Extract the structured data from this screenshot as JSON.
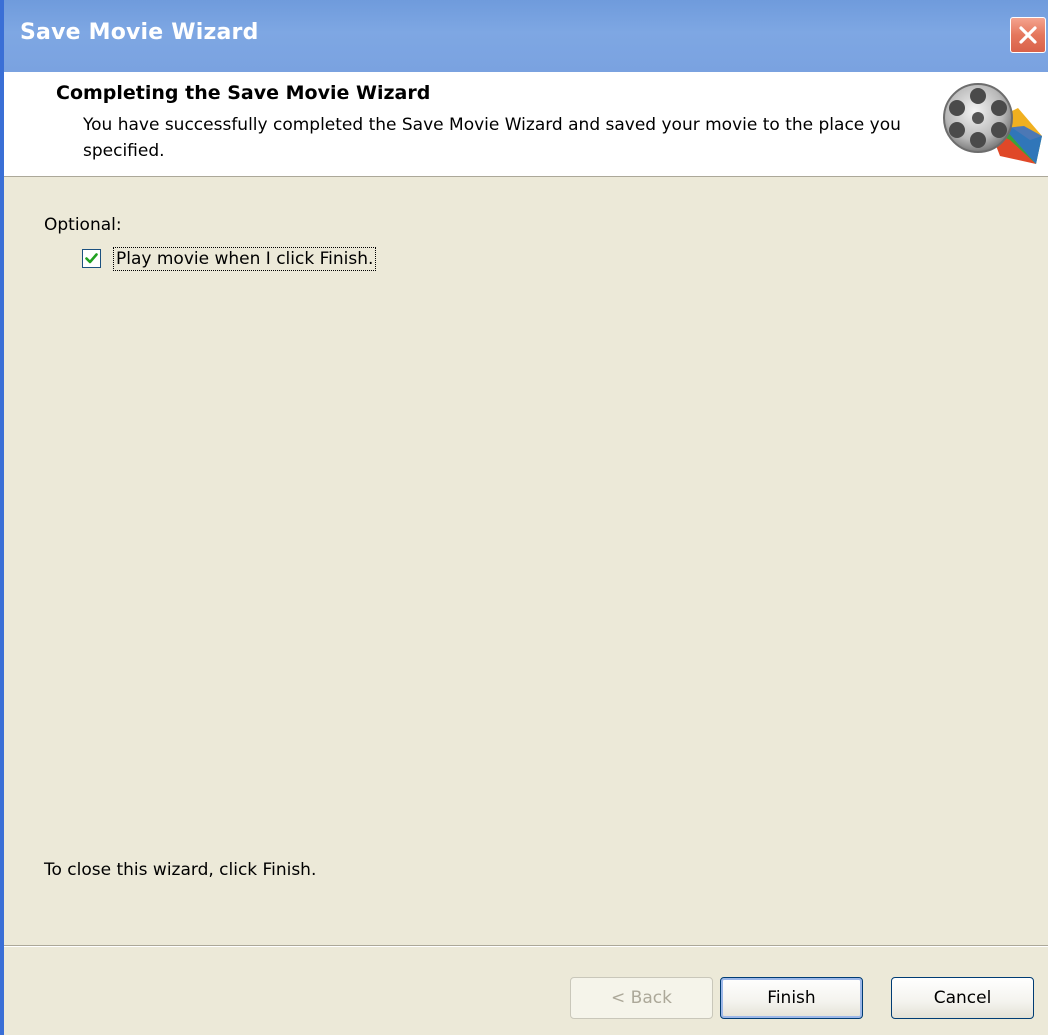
{
  "window": {
    "title": "Save Movie Wizard"
  },
  "header": {
    "title": "Completing the Save Movie Wizard",
    "subtitle": "You have successfully completed the Save Movie Wizard and saved your movie to the place you specified.",
    "icon": "film-reel-icon"
  },
  "body": {
    "optional_label": "Optional:",
    "play_checkbox": {
      "label": "Play movie when I click Finish.",
      "checked": true
    },
    "close_hint": "To close this wizard, click Finish."
  },
  "buttons": {
    "back_label": "< Back",
    "back_enabled": false,
    "finish_label": "Finish",
    "cancel_label": "Cancel"
  },
  "colors": {
    "titlebar": "#7aa2e0",
    "close_button": "#e5775d",
    "dialog_background": "#ece9d8",
    "checkmark": "#21a121"
  }
}
